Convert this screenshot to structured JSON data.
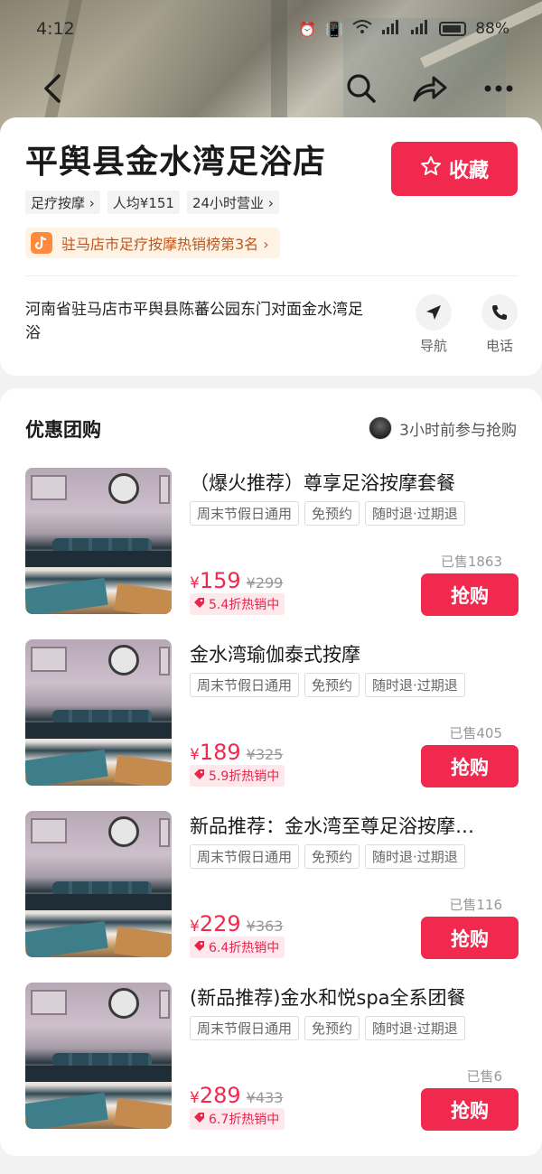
{
  "status_bar": {
    "time": "4:12",
    "battery": "88%"
  },
  "store": {
    "name": "平舆县金水湾足浴店",
    "favorite_label": "收藏",
    "tags": [
      "足疗按摩 ›",
      "人均¥151",
      "24小时营业 ›"
    ],
    "rank": "驻马店市足疗按摩热销榜第3名 ›",
    "address": "河南省驻马店市平舆县陈蕃公园东门对面金水湾足浴",
    "nav_label": "导航",
    "phone_label": "电话"
  },
  "deals": {
    "title": "优惠团购",
    "recent": "3小时前参与抢购",
    "buy_label": "抢购",
    "items": [
      {
        "title": "（爆火推荐）尊享足浴按摩套餐",
        "tags": [
          "周末节假日通用",
          "免预约",
          "随时退·过期退"
        ],
        "sold": "已售1863",
        "currency": "¥",
        "price": "159",
        "orig": "¥299",
        "discount": "5.4折热销中"
      },
      {
        "title": "金水湾瑜伽泰式按摩",
        "tags": [
          "周末节假日通用",
          "免预约",
          "随时退·过期退"
        ],
        "sold": "已售405",
        "currency": "¥",
        "price": "189",
        "orig": "¥325",
        "discount": "5.9折热销中"
      },
      {
        "title": "新品推荐：金水湾至尊足浴按摩…",
        "tags": [
          "周末节假日通用",
          "免预约",
          "随时退·过期退"
        ],
        "sold": "已售116",
        "currency": "¥",
        "price": "229",
        "orig": "¥363",
        "discount": "6.4折热销中"
      },
      {
        "title": "(新品推荐)金水和悦spa全系团餐",
        "tags": [
          "周末节假日通用",
          "免预约",
          "随时退·过期退"
        ],
        "sold": "已售6",
        "currency": "¥",
        "price": "289",
        "orig": "¥433",
        "discount": "6.7折热销中"
      }
    ]
  },
  "colors": {
    "accent": "#f2294f",
    "rank_bg": "#fff3e6",
    "rank_text": "#c0561b"
  }
}
